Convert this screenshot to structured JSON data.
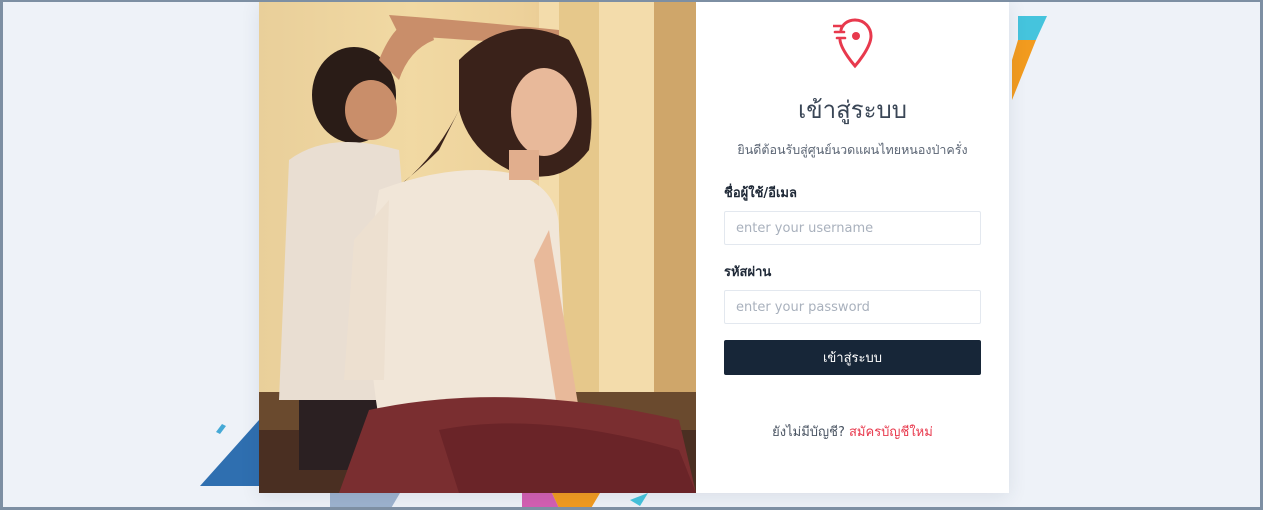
{
  "login": {
    "title": "เข้าสู่ระบบ",
    "subtitle": "ยินดีต้อนรับสู่ศูนย์นวดแผนไทยหนองป่าครั่ง",
    "username_label": "ชื่อผู้ใช้/อีเมล",
    "username_placeholder": "enter your username",
    "password_label": "รหัสผ่าน",
    "password_placeholder": "enter your password",
    "submit_label": "เข้าสู่ระบบ",
    "signup_prompt": "ยังไม่มีบัญชี?",
    "signup_link": "สมัครบัญชีใหม่"
  },
  "icons": {
    "logo": "location-pin-logo-icon"
  },
  "colors": {
    "accent": "#e8394d",
    "button": "#172638",
    "background": "#eef2f8"
  }
}
